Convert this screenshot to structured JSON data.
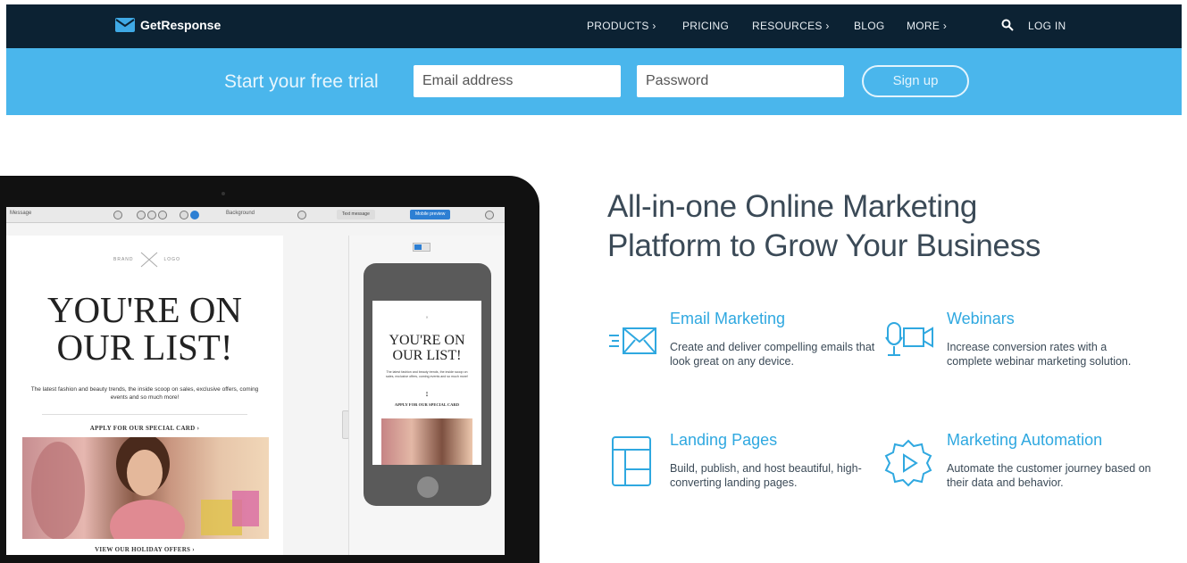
{
  "nav": {
    "brand": "GetResponse",
    "items": [
      "PRODUCTS ›",
      "PRICING",
      "RESOURCES ›",
      "BLOG",
      "MORE ›"
    ],
    "login": "LOG IN"
  },
  "trial": {
    "label": "Start your free trial",
    "email_placeholder": "Email address",
    "password_placeholder": "Password",
    "signup": "Sign up"
  },
  "editor": {
    "toolbar": {
      "message_label": "Message",
      "background_label": "Background",
      "text_message": "Text message",
      "mobile_preview": "Mobile preview"
    },
    "email": {
      "brand_left": "BRAND",
      "brand_right": "LOGO",
      "headline_1": "YOU'RE ON",
      "headline_2": "OUR LIST!",
      "body": "The latest fashion and beauty trends, the inside scoop on sales, exclusive offers, coming events and so much more!",
      "cta": "APPLY FOR OUR SPECIAL CARD ›",
      "footer_cta": "VIEW OUR HOLIDAY OFFERS ›"
    },
    "phone": {
      "headline_1": "YOU'RE ON",
      "headline_2": "OUR LIST!",
      "body": "The latest fashion and beauty trends, the inside scoop on sales, exclusive offers, coming events and so much more!",
      "cta": "APPLY FOR OUR SPECIAL CARD"
    }
  },
  "hero": {
    "headline_1": "All-in-one Online Marketing",
    "headline_2": "Platform to Grow Your Business"
  },
  "features": [
    {
      "title": "Email Marketing",
      "desc": "Create and deliver compelling emails that look great on any device.",
      "icon": "envelope-icon"
    },
    {
      "title": "Webinars",
      "desc": "Increase conversion rates with a complete webinar marketing solution.",
      "icon": "webcam-icon"
    },
    {
      "title": "Landing Pages",
      "desc": "Build, publish, and host beautiful, high-converting landing pages.",
      "icon": "layout-icon"
    },
    {
      "title": "Marketing Automation",
      "desc": "Automate the customer journey based on their data and behavior.",
      "icon": "gear-play-icon"
    }
  ],
  "colors": {
    "nav_bg": "#0c2233",
    "trial_bg": "#4ab6ec",
    "accent": "#2fa8e0",
    "text": "#3b4a57"
  }
}
